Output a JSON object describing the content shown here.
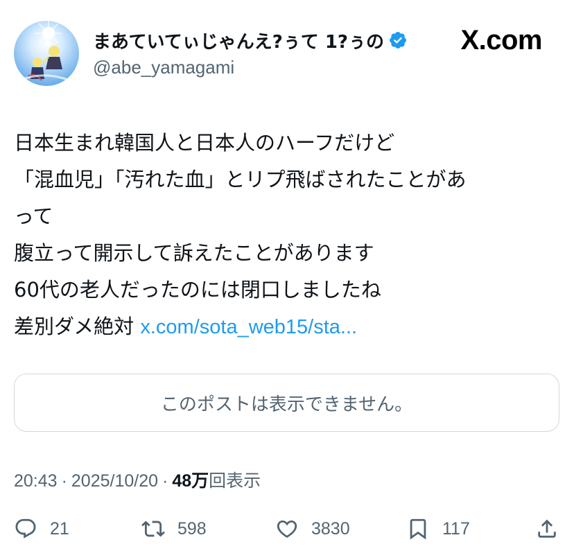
{
  "header": {
    "display_name": "まあていてぃじゃんえ?ぅて 1?ぅの",
    "handle": "@abe_yamagami",
    "brand": "X.com",
    "verified_icon": "verified-badge-icon",
    "avatar_icon": "avatar-anime-illustration"
  },
  "tweet": {
    "lines": [
      "日本生まれ韓国人と日本人のハーフだけど",
      "「混血児」「汚れた血」とリプ飛ばされたことがあ",
      "って",
      "腹立って開示して訴えたことがあります",
      "60代の老人だったのには閉口しましたね"
    ],
    "last_line_prefix": "差別ダメ絶対 ",
    "link_text": "x.com/sota_web15/sta..."
  },
  "quote": {
    "unavailable_text": "このポストは表示できません。"
  },
  "meta": {
    "time": "20:43",
    "separator": "·",
    "date": "2025/10/20",
    "views_count": "48万",
    "views_label": "回表示"
  },
  "actions": {
    "replies": "21",
    "reposts": "598",
    "likes": "3830",
    "bookmarks": "117",
    "icons": [
      "reply-icon",
      "repost-icon",
      "like-icon",
      "bookmark-icon",
      "share-icon"
    ]
  },
  "colors": {
    "text": "#0f1419",
    "secondary": "#536471",
    "link": "#1d9bf0",
    "verified": "#1d9bf0",
    "border": "#cfd9de"
  }
}
